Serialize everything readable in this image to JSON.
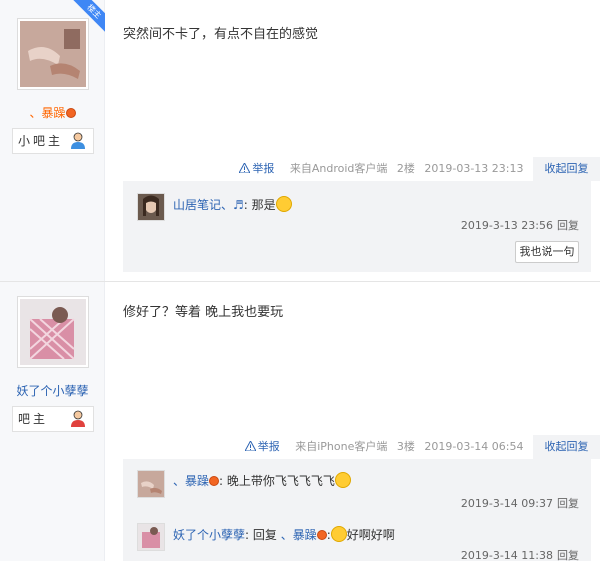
{
  "posts": [
    {
      "badge": "楼主",
      "author": "、暴躁",
      "rank_label": "小吧主",
      "content": "突然间不卡了，有点不自在的感觉",
      "report": "举报",
      "source": "来自Android客户端",
      "floor": "2楼",
      "time": "2019-03-13 23:13",
      "reply_toggle": "收起回复",
      "replies": [
        {
          "user": "山居笔记、♬",
          "text": ": 那是",
          "time": "2019-3-13 23:56",
          "reply_link": "回复"
        }
      ],
      "say_button": "我也说一句"
    },
    {
      "author": "妖了个小孽孽",
      "rank_label": "吧主",
      "content": "修好了？等着 晚上我也要玩",
      "report": "举报",
      "source": "来自iPhone客户端",
      "floor": "3楼",
      "time": "2019-03-14 06:54",
      "reply_toggle": "收起回复",
      "replies": [
        {
          "user": "、暴躁",
          "text": ": 晚上带你飞飞飞飞飞",
          "time": "2019-3-14 09:37",
          "reply_link": "回复"
        },
        {
          "user": "妖了个小孽孽",
          "text_prefix": ": 回复 ",
          "target": "、暴躁",
          "text": ":",
          "text_suffix": "好啊好啊",
          "time": "2019-3-14 11:38",
          "reply_link": "回复"
        }
      ]
    }
  ],
  "colors": {
    "link": "#2d64b3",
    "meta": "#999999",
    "orange_name": "#ff6600",
    "panel": "#f2f3f5",
    "badge_blue": "#3f87f5"
  }
}
